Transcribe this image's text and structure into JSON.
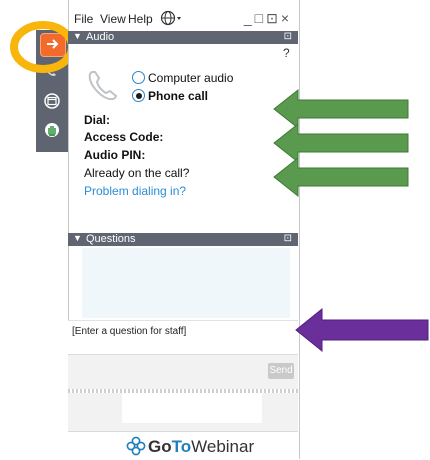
{
  "menu": {
    "file": "File",
    "view": "View",
    "help": "Help"
  },
  "window_controls": "_□⊡×",
  "audio": {
    "title": "Audio",
    "help": "?",
    "options": [
      {
        "label": "Computer audio",
        "selected": false
      },
      {
        "label": "Phone call",
        "selected": true
      }
    ],
    "dial_label": "Dial:",
    "access_code_label": "Access Code:",
    "audio_pin_label": "Audio PIN:",
    "already_label": "Already on the call?",
    "problem_link": "Problem dialing in?"
  },
  "questions": {
    "title": "Questions",
    "input_placeholder": "[Enter a question for staff]",
    "send_label": "Send"
  },
  "brand": {
    "go": "Go",
    "to": "To",
    "webinar": "Webinar"
  },
  "colors": {
    "accent_orange": "#f26b2a",
    "highlight_ring": "#f8b60d",
    "arrow_green": "#5a9a4e",
    "arrow_purple": "#6b2f9b",
    "link": "#2a8dd6"
  }
}
